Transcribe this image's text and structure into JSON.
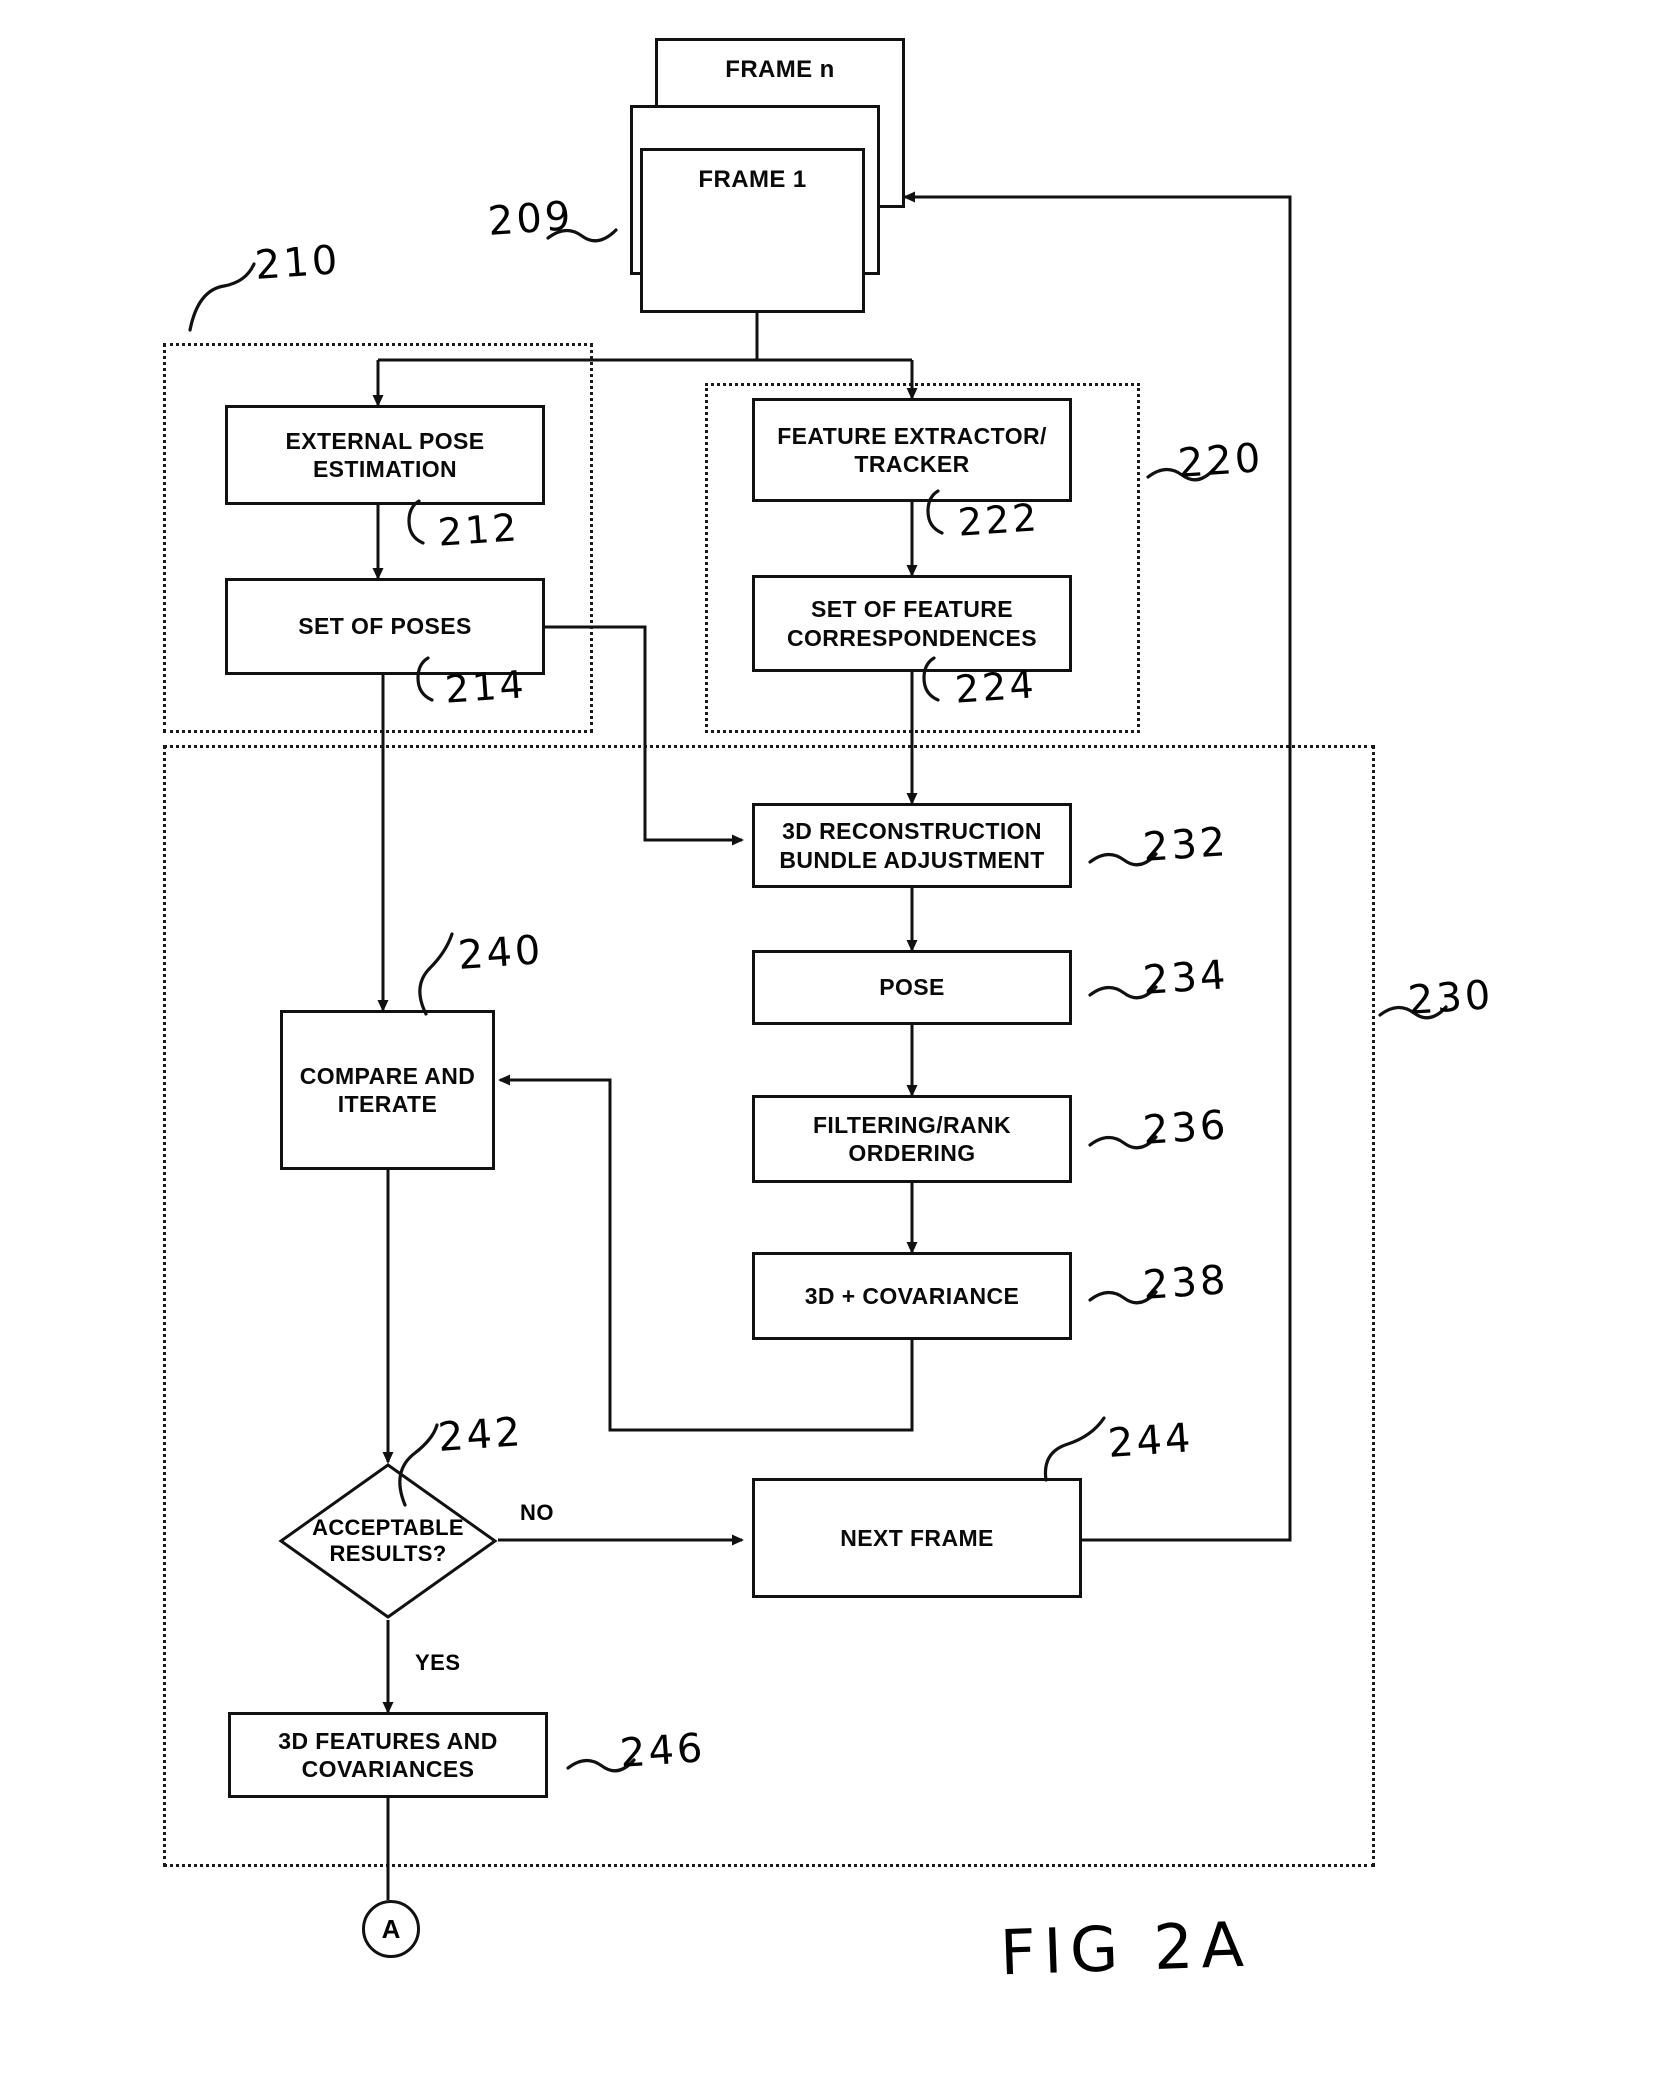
{
  "figure": {
    "caption": "FIG 2A"
  },
  "nodes": {
    "frame_n": {
      "label": "FRAME n"
    },
    "frame_mid": {
      "label": ""
    },
    "frame_1": {
      "label": "FRAME 1"
    },
    "external_pose_estimation": {
      "label": "EXTERNAL POSE ESTIMATION"
    },
    "set_of_poses": {
      "label": "SET OF POSES"
    },
    "feature_extractor_tracker": {
      "label": "FEATURE EXTRACTOR/ TRACKER"
    },
    "set_of_feature_correspondences": {
      "label": "SET OF FEATURE CORRESPONDENCES"
    },
    "bundle_adjustment": {
      "label": "3D RECONSTRUCTION BUNDLE ADJUSTMENT"
    },
    "pose": {
      "label": "POSE"
    },
    "filtering_rank_ordering": {
      "label": "FILTERING/RANK ORDERING"
    },
    "three_d_covariance": {
      "label": "3D + COVARIANCE"
    },
    "compare_and_iterate": {
      "label": "COMPARE AND ITERATE"
    },
    "acceptable_results": {
      "label": "ACCEPTABLE RESULTS?"
    },
    "next_frame": {
      "label": "NEXT FRAME"
    },
    "three_d_features_and_covariances": {
      "label": "3D FEATURES AND COVARIANCES"
    },
    "connector_a": {
      "label": "A"
    }
  },
  "edge_labels": {
    "no": "NO",
    "yes": "YES"
  },
  "reference_numerals": {
    "frames": "209",
    "external_pose_group": "210",
    "external_pose_estimation": "212",
    "set_of_poses": "214",
    "feature_group": "220",
    "feature_extractor_tracker": "222",
    "set_of_feature_correspondences": "224",
    "reconstruction_group": "230",
    "bundle_adjustment": "232",
    "pose": "234",
    "filtering_rank_ordering": "236",
    "three_d_covariance": "238",
    "compare_and_iterate": "240",
    "acceptable_results": "242",
    "next_frame": "244",
    "three_d_features_and_covariances": "246"
  },
  "colors": {
    "ink": "#0a0a0a",
    "paper": "#ffffff"
  }
}
